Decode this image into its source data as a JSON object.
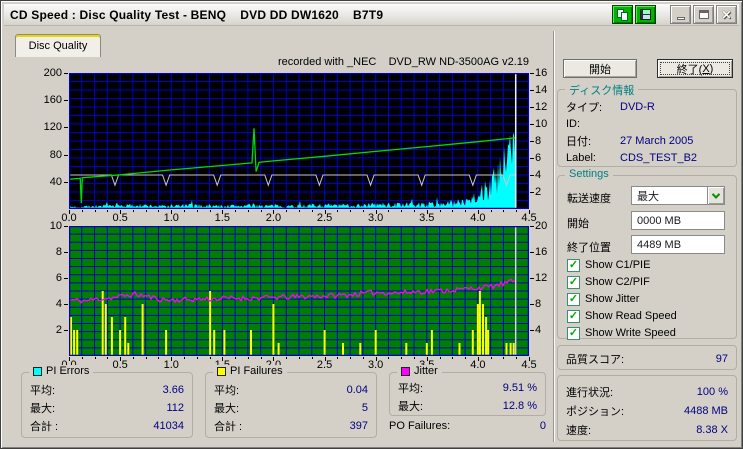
{
  "window": {
    "title": "CD Speed : Disc Quality Test - BENQ    DVD DD DW1620    B7T9",
    "titlebar_buttons": [
      "copy",
      "save",
      "minimize",
      "maximize",
      "close"
    ]
  },
  "tab": {
    "label": "Disc Quality"
  },
  "chart_header": "recorded with _NEC    DVD_RW ND-3500AG v2.19",
  "chart_data": [
    {
      "type": "line",
      "title": "recorded with _NEC    DVD_RW ND-3500AG v2.19",
      "bg": "#000000",
      "grid": "#0000cd",
      "end_marker_color": "#f0f0f0",
      "x_axis": {
        "range": [
          0,
          4.5
        ],
        "minor_step": 0.125,
        "ticks": [
          "0.0",
          "0.5",
          "1.0",
          "1.5",
          "2.0",
          "2.5",
          "3.0",
          "3.5",
          "4.0",
          "4.5"
        ]
      },
      "left_axis": {
        "name": "PI Errors",
        "range": [
          0,
          200
        ],
        "labels": [
          "200",
          "160",
          "120",
          "80",
          "40"
        ]
      },
      "right_axis": {
        "name": "Read/Write Speed (X)",
        "range": [
          0,
          16
        ],
        "labels": [
          "16",
          "14",
          "12",
          "10",
          "8",
          "6",
          "4",
          "2"
        ]
      },
      "data_end_x": 4.37,
      "series": [
        {
          "name": "pi-errors",
          "color": "#00ffff",
          "axis": "left",
          "style": "noise-area",
          "base_points": [
            [
              0,
              3
            ],
            [
              0.3,
              4
            ],
            [
              0.6,
              5
            ],
            [
              0.9,
              4
            ],
            [
              1.2,
              5
            ],
            [
              1.5,
              4
            ],
            [
              1.8,
              5
            ],
            [
              2.1,
              4
            ],
            [
              2.4,
              5
            ],
            [
              2.7,
              5
            ],
            [
              3.0,
              6
            ],
            [
              3.3,
              6
            ],
            [
              3.6,
              7
            ],
            [
              3.8,
              9
            ],
            [
              3.9,
              14
            ],
            [
              4.0,
              20
            ],
            [
              4.1,
              30
            ],
            [
              4.2,
              46
            ],
            [
              4.25,
              58
            ],
            [
              4.3,
              72
            ],
            [
              4.33,
              90
            ],
            [
              4.36,
              112
            ],
            [
              4.37,
              95
            ]
          ]
        },
        {
          "name": "write-speed",
          "color": "#c8c8c8",
          "axis": "right",
          "style": "line-with-dips",
          "value": 4.0,
          "dip_depth": 1.2,
          "dip_xs": [
            0.45,
            0.95,
            1.45,
            1.95,
            2.45,
            2.95,
            3.45,
            3.95,
            4.28
          ]
        },
        {
          "name": "read-speed",
          "color": "#00dc00",
          "axis": "right",
          "style": "line",
          "points": [
            [
              0,
              3.5
            ],
            [
              0.1,
              3.6
            ],
            [
              0.11,
              3.62
            ],
            [
              0.12,
              0.7
            ],
            [
              0.13,
              3.68
            ],
            [
              0.5,
              4.02
            ],
            [
              1.0,
              4.6
            ],
            [
              1.5,
              5.12
            ],
            [
              1.79,
              5.42
            ],
            [
              1.81,
              9.5
            ],
            [
              1.83,
              4.4
            ],
            [
              1.86,
              5.5
            ],
            [
              2.0,
              5.66
            ],
            [
              2.5,
              6.2
            ],
            [
              3.0,
              6.78
            ],
            [
              3.5,
              7.34
            ],
            [
              4.0,
              7.92
            ],
            [
              4.37,
              8.38
            ]
          ]
        }
      ]
    },
    {
      "type": "bar+line",
      "bg": "#007e00",
      "grid": "#0000cd",
      "end_marker_color": "#d8d8d0",
      "x_axis": {
        "range": [
          0,
          4.5
        ],
        "minor_step": 0.125,
        "ticks": [
          "0.0",
          "0.5",
          "1.0",
          "1.5",
          "2.0",
          "2.5",
          "3.0",
          "3.5",
          "4.0",
          "4.5"
        ]
      },
      "left_axis": {
        "name": "PI Failures",
        "range": [
          0,
          10
        ],
        "labels": [
          "10",
          "8",
          "6",
          "4",
          "2"
        ]
      },
      "right_axis": {
        "name": "Jitter %",
        "range": [
          0,
          20
        ],
        "labels": [
          "20",
          "16",
          "12",
          "8",
          "4"
        ]
      },
      "data_end_x": 4.37,
      "series": [
        {
          "name": "pi-failures",
          "color": "#ffff00",
          "axis": "left",
          "style": "bars",
          "bars": [
            [
              0.02,
              3
            ],
            [
              0.05,
              2
            ],
            [
              0.08,
              2
            ],
            [
              0.33,
              5
            ],
            [
              0.36,
              4
            ],
            [
              0.42,
              3
            ],
            [
              0.5,
              2
            ],
            [
              0.55,
              3
            ],
            [
              0.58,
              1
            ],
            [
              0.72,
              4
            ],
            [
              0.95,
              2
            ],
            [
              1.38,
              5
            ],
            [
              1.42,
              2
            ],
            [
              1.52,
              2
            ],
            [
              1.78,
              2
            ],
            [
              2.0,
              4
            ],
            [
              2.05,
              1
            ],
            [
              2.5,
              2
            ],
            [
              2.68,
              1
            ],
            [
              2.85,
              1
            ],
            [
              3.0,
              2
            ],
            [
              3.3,
              1
            ],
            [
              3.5,
              1
            ],
            [
              3.55,
              2
            ],
            [
              3.82,
              1
            ],
            [
              3.95,
              2
            ],
            [
              4.0,
              4
            ],
            [
              4.02,
              5
            ],
            [
              4.05,
              4
            ],
            [
              4.08,
              3
            ],
            [
              4.1,
              2
            ],
            [
              4.28,
              1
            ],
            [
              4.32,
              1
            ],
            [
              4.35,
              1
            ]
          ]
        },
        {
          "name": "jitter",
          "color": "#ff00ff",
          "axis": "right",
          "style": "noisy-line",
          "noise": 0.4,
          "points": [
            [
              0,
              8.6
            ],
            [
              0.15,
              8.5
            ],
            [
              0.3,
              8.8
            ],
            [
              0.45,
              9.0
            ],
            [
              0.55,
              9.3
            ],
            [
              0.65,
              9.5
            ],
            [
              0.75,
              9.2
            ],
            [
              0.9,
              8.7
            ],
            [
              1.0,
              8.6
            ],
            [
              1.2,
              8.7
            ],
            [
              1.4,
              8.8
            ],
            [
              1.6,
              8.9
            ],
            [
              1.8,
              8.9
            ],
            [
              2.0,
              9.0
            ],
            [
              2.2,
              9.1
            ],
            [
              2.4,
              9.2
            ],
            [
              2.6,
              9.3
            ],
            [
              2.8,
              9.5
            ],
            [
              3.0,
              9.8
            ],
            [
              3.2,
              9.7
            ],
            [
              3.4,
              9.9
            ],
            [
              3.6,
              10.0
            ],
            [
              3.8,
              10.2
            ],
            [
              4.0,
              10.5
            ],
            [
              4.1,
              10.6
            ],
            [
              4.2,
              10.9
            ],
            [
              4.3,
              11.3
            ],
            [
              4.37,
              11.6
            ]
          ]
        }
      ]
    }
  ],
  "legend": {
    "pi_errors": {
      "title": "PI Errors",
      "color": "#00ffff",
      "rows": [
        [
          "平均:",
          "3.66"
        ],
        [
          "最大:",
          "112"
        ],
        [
          "合計 :",
          "41034"
        ]
      ]
    },
    "pi_failures": {
      "title": "PI Failures",
      "color": "#ffff00",
      "rows": [
        [
          "平均:",
          "0.04"
        ],
        [
          "最大:",
          "5"
        ],
        [
          "合計 :",
          "397"
        ]
      ]
    },
    "jitter": {
      "title": "Jitter",
      "color": "#ff00ff",
      "rows": [
        [
          "平均:",
          "9.51 %"
        ],
        [
          "最大:",
          "12.8 %"
        ]
      ]
    },
    "po_failures": {
      "label": "PO Failures:",
      "value": "0"
    }
  },
  "panel": {
    "start_button": "開始",
    "exit_prefix": "終了(",
    "exit_accel": "X",
    "exit_suffix": ")",
    "disc_info": {
      "title": "ディスク情報",
      "rows": [
        [
          "タイプ:",
          "DVD-R"
        ],
        [
          "ID:",
          ""
        ],
        [
          "日付:",
          "27 March 2005"
        ],
        [
          "Label:",
          "CDS_TEST_B2"
        ]
      ]
    },
    "settings": {
      "title": "Settings",
      "speed_label": "転送速度",
      "speed_value": "最大",
      "start_label": "開始",
      "start_value": "0000 MB",
      "end_label": "終了位置",
      "end_value": "4489 MB",
      "checkboxes": [
        "Show C1/PIE",
        "Show C2/PIF",
        "Show Jitter",
        "Show Read Speed",
        "Show Write Speed"
      ]
    },
    "score": {
      "label": "品質スコア:",
      "value": "97"
    },
    "progress": {
      "rows": [
        [
          "進行状況:",
          "100 %"
        ],
        [
          "ポジション:",
          "4488 MB"
        ],
        [
          "速度:",
          "8.38 X"
        ]
      ]
    }
  },
  "colors": {
    "value_navy": "#000080",
    "group_teal": "#008080",
    "tab_stripe": "#e8d800",
    "check_green": "#00aa00",
    "titlebar_button_green": "#00b400"
  }
}
